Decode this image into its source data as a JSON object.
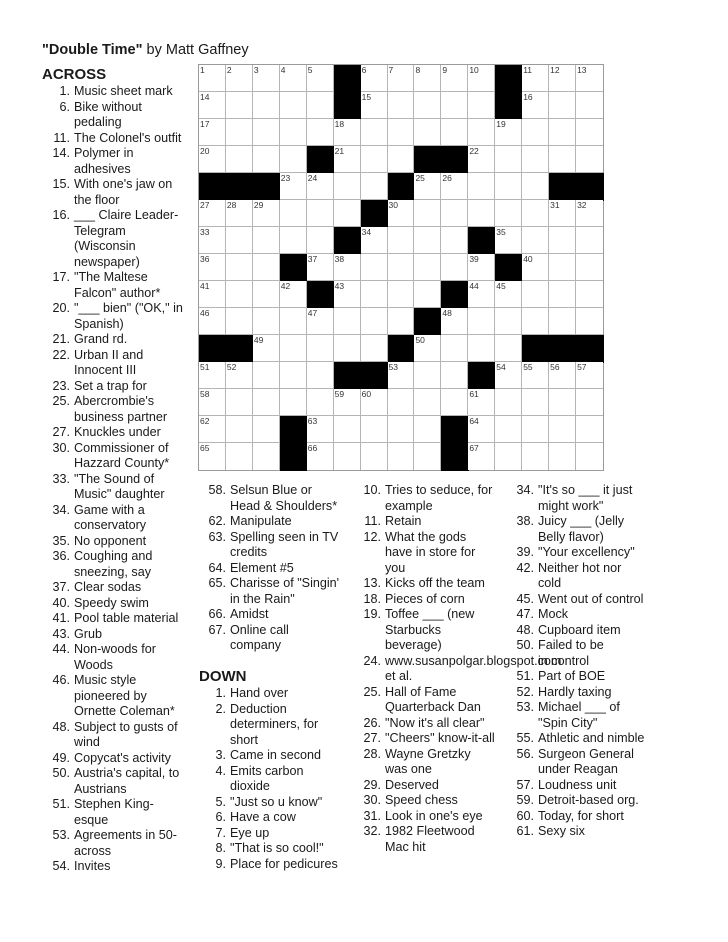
{
  "title": {
    "name": "\"Double Time\"",
    "byline": " by Matt Gaffney"
  },
  "across_heading": "ACROSS",
  "down_heading": "DOWN",
  "grid": {
    "rows": 15,
    "cols": 15,
    "pattern": [
      ".....#.....#...",
      ".....#.....#...",
      "...............",
      "....#...##.....",
      "###....#.....##",
      "......#........",
      ".....#....#....",
      "...#.......#...",
      "....#....#.....",
      "........#......",
      "##.....#....###",
      ".....##...#....",
      "...............",
      "...#.....#.....",
      "...#.....#....."
    ]
  },
  "across_col1": [
    {
      "n": "1.",
      "t": "Music sheet mark"
    },
    {
      "n": "6.",
      "t": "Bike without\npedaling"
    },
    {
      "n": "11.",
      "t": "The Colonel's outfit"
    },
    {
      "n": "14.",
      "t": "Polymer in\nadhesives"
    },
    {
      "n": "15.",
      "t": "With one's jaw on\nthe floor"
    },
    {
      "n": "16.",
      "t": "___ Claire Leader-\nTelegram\n(Wisconsin\nnewspaper)"
    },
    {
      "n": "17.",
      "t": "\"The Maltese\nFalcon\" author*"
    },
    {
      "n": "20.",
      "t": "\"___ bien\" (\"OK,\" in\nSpanish)"
    },
    {
      "n": "21.",
      "t": "Grand rd."
    },
    {
      "n": "22.",
      "t": "Urban II and\nInnocent III"
    },
    {
      "n": "23.",
      "t": "Set a trap for"
    },
    {
      "n": "25.",
      "t": "Abercrombie's\nbusiness partner"
    },
    {
      "n": "27.",
      "t": "Knuckles under"
    },
    {
      "n": "30.",
      "t": "Commissioner of\nHazzard County*"
    },
    {
      "n": "33.",
      "t": "\"The Sound of\nMusic\" daughter"
    },
    {
      "n": "34.",
      "t": "Game with a\nconservatory"
    },
    {
      "n": "35.",
      "t": "No opponent"
    },
    {
      "n": "36.",
      "t": "Coughing and\nsneezing, say"
    },
    {
      "n": "37.",
      "t": "Clear sodas"
    },
    {
      "n": "40.",
      "t": "Speedy swim"
    },
    {
      "n": "41.",
      "t": "Pool table material"
    },
    {
      "n": "43.",
      "t": "Grub"
    },
    {
      "n": "44.",
      "t": "Non-woods for\nWoods"
    },
    {
      "n": "46.",
      "t": "Music style\npioneered by\nOrnette Coleman*"
    },
    {
      "n": "48.",
      "t": "Subject to gusts of\nwind"
    },
    {
      "n": "49.",
      "t": "Copycat's activity"
    },
    {
      "n": "50.",
      "t": "Austria's capital, to\nAustrians"
    },
    {
      "n": "51.",
      "t": "Stephen King-\nesque"
    },
    {
      "n": "53.",
      "t": "Agreements in 50-\nacross"
    },
    {
      "n": "54.",
      "t": "Invites"
    }
  ],
  "across_col2": [
    {
      "n": "58.",
      "t": "Selsun Blue or\nHead & Shoulders*"
    },
    {
      "n": "62.",
      "t": "Manipulate"
    },
    {
      "n": "63.",
      "t": "Spelling seen in TV\ncredits"
    },
    {
      "n": "64.",
      "t": "Element #5"
    },
    {
      "n": "65.",
      "t": "Charisse of \"Singin'\nin the Rain\""
    },
    {
      "n": "66.",
      "t": "Amidst"
    },
    {
      "n": "67.",
      "t": "Online call\ncompany"
    }
  ],
  "down_col1": [
    {
      "n": "1.",
      "t": "Hand over"
    },
    {
      "n": "2.",
      "t": "Deduction\ndeterminers, for\nshort"
    },
    {
      "n": "3.",
      "t": "Came in second"
    },
    {
      "n": "4.",
      "t": "Emits carbon\ndioxide"
    },
    {
      "n": "5.",
      "t": "\"Just so u know\""
    },
    {
      "n": "6.",
      "t": "Have a cow"
    },
    {
      "n": "7.",
      "t": "Eye up"
    },
    {
      "n": "8.",
      "t": "\"That is so cool!\""
    },
    {
      "n": "9.",
      "t": "Place for pedicures"
    }
  ],
  "down_col2": [
    {
      "n": "10.",
      "t": "Tries to seduce, for\nexample"
    },
    {
      "n": "11.",
      "t": "Retain"
    },
    {
      "n": "12.",
      "t": "What the gods\nhave in store for\nyou"
    },
    {
      "n": "13.",
      "t": "Kicks off the team"
    },
    {
      "n": "18.",
      "t": "Pieces of corn"
    },
    {
      "n": "19.",
      "t": "Toffee ___ (new\nStarbucks\nbeverage)"
    },
    {
      "n": "24.",
      "t": "www.susanpolgar.blogspot.com\net al."
    },
    {
      "n": "25.",
      "t": "Hall of Fame\nQuarterback Dan"
    },
    {
      "n": "26.",
      "t": "\"Now it's all clear\""
    },
    {
      "n": "27.",
      "t": "\"Cheers\" know-it-all"
    },
    {
      "n": "28.",
      "t": "Wayne Gretzky\nwas one"
    },
    {
      "n": "29.",
      "t": "Deserved"
    },
    {
      "n": "30.",
      "t": "Speed chess"
    },
    {
      "n": "31.",
      "t": "Look in one's eye"
    },
    {
      "n": "32.",
      "t": "1982 Fleetwood\nMac hit"
    }
  ],
  "down_col3": [
    {
      "n": "34.",
      "t": "\"It's so ___ it just\nmight work\""
    },
    {
      "n": "38.",
      "t": "Juicy ___ (Jelly\nBelly flavor)"
    },
    {
      "n": "39.",
      "t": "\"Your excellency\""
    },
    {
      "n": "42.",
      "t": "Neither hot nor\ncold"
    },
    {
      "n": "45.",
      "t": "Went out of control"
    },
    {
      "n": "47.",
      "t": "Mock"
    },
    {
      "n": "48.",
      "t": "Cupboard item"
    },
    {
      "n": "50.",
      "t": "Failed to be\nin control"
    },
    {
      "n": "51.",
      "t": "Part of BOE"
    },
    {
      "n": "52.",
      "t": "Hardly taxing"
    },
    {
      "n": "53.",
      "t": "Michael ___ of\n\"Spin City\""
    },
    {
      "n": "55.",
      "t": "Athletic and nimble"
    },
    {
      "n": "56.",
      "t": "Surgeon General\nunder Reagan"
    },
    {
      "n": "57.",
      "t": "Loudness unit"
    },
    {
      "n": "59.",
      "t": "Detroit-based org."
    },
    {
      "n": "60.",
      "t": "Today, for short"
    },
    {
      "n": "61.",
      "t": "Sexy six"
    }
  ]
}
